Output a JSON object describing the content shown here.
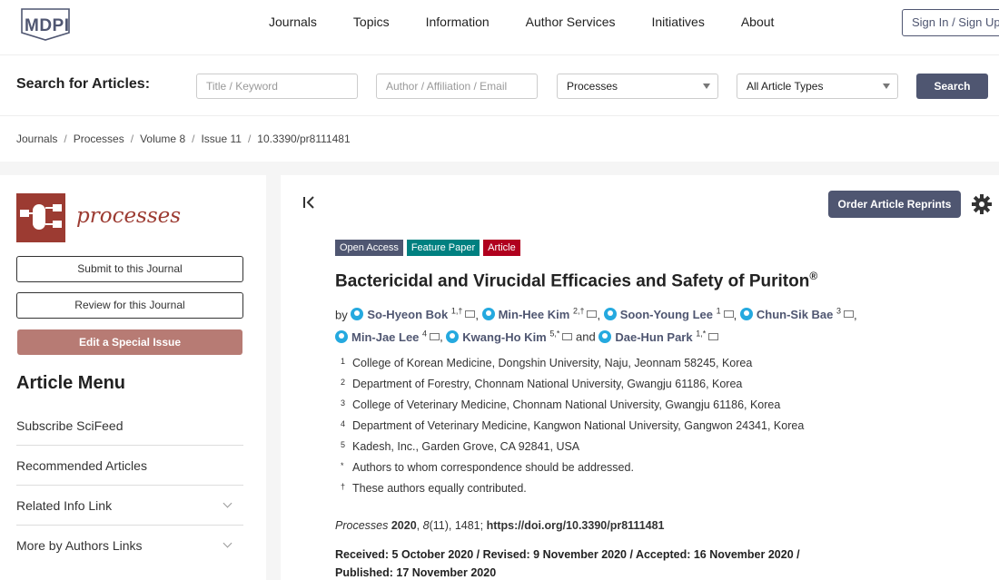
{
  "brand": {
    "name": "MDPI"
  },
  "nav": {
    "items": [
      "Journals",
      "Topics",
      "Information",
      "Author Services",
      "Initiatives",
      "About"
    ],
    "signin": "Sign In / Sign Up"
  },
  "search": {
    "title": "Search for Articles:",
    "keyword_placeholder": "Title / Keyword",
    "author_placeholder": "Author / Affiliation / Email",
    "journal_selected": "Processes",
    "type_selected": "All Article Types",
    "button": "Search"
  },
  "breadcrumb": [
    "Journals",
    "Processes",
    "Volume 8",
    "Issue 11",
    "10.3390/pr8111481"
  ],
  "sidebar": {
    "journal_name": "processes",
    "submit": "Submit to this Journal",
    "review": "Review for this Journal",
    "special": "Edit a Special Issue",
    "menu_title": "Article Menu",
    "menu_items": [
      "Subscribe SciFeed",
      "Recommended Articles",
      "Related Info Link",
      "More by Authors Links"
    ]
  },
  "article": {
    "reprints": "Order Article Reprints",
    "badges": [
      "Open Access",
      "Feature Paper",
      "Article"
    ],
    "title": "Bactericidal and Virucidal Efficacies and Safety of Puriton",
    "title_sup": "®",
    "by": "by",
    "authors": [
      {
        "name": "So-Hyeon Bok",
        "sup": "1,†"
      },
      {
        "name": "Min-Hee Kim",
        "sup": "2,†"
      },
      {
        "name": "Soon-Young Lee",
        "sup": "1"
      },
      {
        "name": "Chun-Sik Bae",
        "sup": "3"
      },
      {
        "name": "Min-Jae Lee",
        "sup": "4"
      },
      {
        "name": "Kwang-Ho Kim",
        "sup": "5,*"
      },
      {
        "name": "Dae-Hun Park",
        "sup": "1,*"
      }
    ],
    "and": "and",
    "affiliations": [
      {
        "num": "1",
        "text": "College of Korean Medicine, Dongshin University, Naju, Jeonnam 58245, Korea"
      },
      {
        "num": "2",
        "text": "Department of Forestry, Chonnam National University, Gwangju 61186, Korea"
      },
      {
        "num": "3",
        "text": "College of Veterinary Medicine, Chonnam National University, Gwangju 61186, Korea"
      },
      {
        "num": "4",
        "text": "Department of Veterinary Medicine, Kangwon National University, Gangwon 24341, Korea"
      },
      {
        "num": "5",
        "text": "Kadesh, Inc., Garden Grove, CA 92841, USA"
      },
      {
        "num": "*",
        "text": "Authors to whom correspondence should be addressed."
      },
      {
        "num": "†",
        "text": "These authors equally contributed."
      }
    ],
    "citation": {
      "journal": "Processes",
      "year": "2020",
      "vol": "8",
      "issue": "(11)",
      "pages": ", 1481; ",
      "doi": "https://doi.org/10.3390/pr8111481"
    },
    "dates": "Received: 5 October 2020 / Revised: 9 November 2020 / Accepted: 16 November 2020 / Published: 17 November 2020"
  }
}
